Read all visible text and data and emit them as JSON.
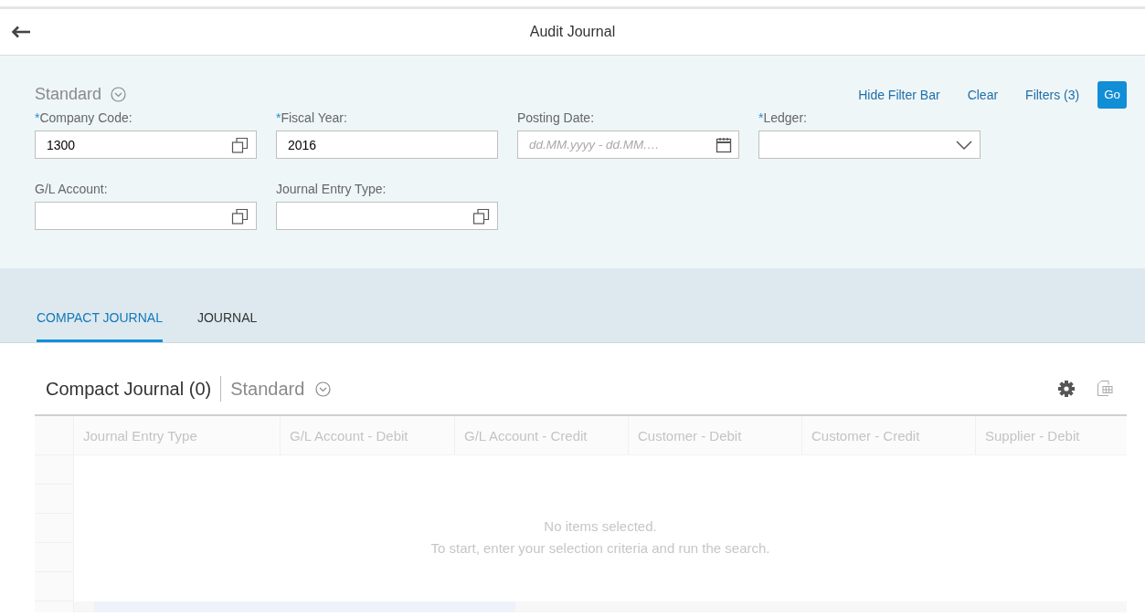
{
  "header": {
    "title": "Audit Journal"
  },
  "filter_bar": {
    "variant": "Standard",
    "actions": [
      "Hide Filter Bar",
      "Clear",
      "Filters (3)"
    ],
    "go_button": "Go",
    "fields": [
      {
        "label": "Company Code:",
        "required_mark": "*",
        "kind": "valuehelp",
        "value": "1300"
      },
      {
        "label": "Fiscal Year:",
        "required_mark": "*",
        "kind": "text",
        "value": "2016"
      },
      {
        "label": "Posting Date:",
        "kind": "date",
        "placeholder": "dd.MM.yyyy - dd.MM.…"
      },
      {
        "label": "Ledger:",
        "required_mark": "*",
        "kind": "select"
      },
      {
        "label": "G/L Account:",
        "kind": "valuehelp"
      },
      {
        "label": "Journal Entry Type:",
        "kind": "valuehelp"
      }
    ]
  },
  "tabs": [
    {
      "label": "COMPACT JOURNAL",
      "selected": true
    },
    {
      "label": "JOURNAL",
      "selected": false
    }
  ],
  "table": {
    "title": "Compact Journal (0)",
    "variant": "Standard",
    "columns": [
      "Journal Entry Type",
      "G/L Account - Debit",
      "G/L Account - Credit",
      "Customer - Debit",
      "Customer - Credit",
      "Supplier - Debit"
    ],
    "empty_message": [
      "No items selected.",
      "To start, enter your selection criteria and run the search."
    ]
  }
}
